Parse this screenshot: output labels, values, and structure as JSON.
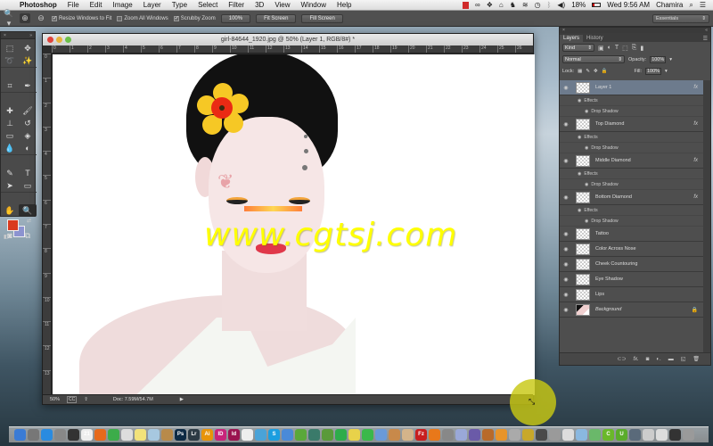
{
  "menubar": {
    "apple_icon": "apple-logo",
    "app_name": "Photoshop",
    "menus": [
      "File",
      "Edit",
      "Image",
      "Layer",
      "Type",
      "Select",
      "Filter",
      "3D",
      "View",
      "Window",
      "Help"
    ],
    "status_icons": [
      "creative-cloud-icon",
      "dropbox-icon",
      "home-icon",
      "evernote-icon",
      "wifi-icon",
      "time-machine-icon",
      "bluetooth-icon",
      "volume-icon"
    ],
    "battery": "18%",
    "clock": "Wed 9:56 AM",
    "user": "Chamira",
    "search_icon": "spotlight-icon",
    "list_icon": "notification-center-icon"
  },
  "options_bar": {
    "tool": "zoom-tool",
    "resize_windows": {
      "label": "Resize Windows to Fit",
      "checked": true
    },
    "zoom_all": {
      "label": "Zoom All Windows",
      "checked": false
    },
    "scrubby": {
      "label": "Scrubby Zoom",
      "checked": true
    },
    "btn_100": "100%",
    "btn_fit": "Fit Screen",
    "btn_fill": "Fill Screen",
    "workspace": "Essentials"
  },
  "tools": {
    "items": [
      "marquee",
      "move",
      "lasso",
      "magic-wand",
      "crop",
      "eyedropper",
      "healing",
      "brush",
      "stamp",
      "history-brush",
      "eraser",
      "paint-bucket",
      "blur",
      "dodge",
      "pen",
      "type",
      "path-select",
      "rectangle",
      "hand",
      "zoom"
    ],
    "glyphs": [
      "⬚",
      "✥",
      "➰",
      "✨",
      "⌗",
      "✒",
      "✚",
      "🖌",
      "⊥",
      "↺",
      "▭",
      "◈",
      "💧",
      "◐",
      "✎",
      "T",
      "➤",
      "▭",
      "✋",
      "🔍"
    ],
    "fg_color": "#d93a1f",
    "bg_color": "#8c93d0"
  },
  "document": {
    "title": "girl-84644_1920.jpg @ 50% (Layer 1, RGB/8#) *",
    "ruler_h": [
      "0",
      "1",
      "2",
      "3",
      "4",
      "5",
      "6",
      "7",
      "8",
      "9",
      "10",
      "11",
      "12",
      "13",
      "14",
      "15",
      "16",
      "17",
      "18",
      "19",
      "20",
      "21",
      "22",
      "23",
      "24",
      "25",
      "26"
    ],
    "ruler_v": [
      "0",
      "1",
      "2",
      "3",
      "4",
      "5",
      "6",
      "7",
      "8",
      "9",
      "10",
      "11",
      "12",
      "13"
    ],
    "zoom": "50%",
    "doc_size": "Doc: 7.59M/54.7M",
    "watermark": "www.cgtsj.com"
  },
  "layers_panel": {
    "tabs": [
      "Layers",
      "History"
    ],
    "filter_kind": "Kind",
    "blend_mode": "Normal",
    "opacity_label": "Opacity:",
    "opacity": "100%",
    "lock_label": "Lock:",
    "fill_label": "Fill:",
    "fill": "100%",
    "layers": [
      {
        "name": "Layer 1",
        "selected": true,
        "fx": true,
        "effects": [
          "Effects",
          "Drop Shadow"
        ]
      },
      {
        "name": "Top Diamond",
        "selected": false,
        "fx": true,
        "effects": [
          "Effects",
          "Drop Shadow"
        ]
      },
      {
        "name": "Middle Diamond",
        "selected": false,
        "fx": true,
        "effects": [
          "Effects",
          "Drop Shadow"
        ]
      },
      {
        "name": "Bottom Diamond",
        "selected": false,
        "fx": true,
        "effects": [
          "Effects",
          "Drop Shadow"
        ]
      },
      {
        "name": "Tattoo",
        "selected": false,
        "fx": false
      },
      {
        "name": "Color Across Nose",
        "selected": false,
        "fx": false
      },
      {
        "name": "Cheek Countouring",
        "selected": false,
        "fx": false
      },
      {
        "name": "Eye Shadow",
        "selected": false,
        "fx": false
      },
      {
        "name": "Lips",
        "selected": false,
        "fx": false
      },
      {
        "name": "Background",
        "selected": false,
        "fx": false,
        "locked": true,
        "italic": true
      }
    ],
    "fx_label": "fx",
    "bottom_icons": [
      "link-icon",
      "fx-icon",
      "mask-icon",
      "adjustment-icon",
      "group-folder-icon",
      "new-layer-icon",
      "trash-icon"
    ]
  },
  "dock": {
    "apps": [
      {
        "name": "finder",
        "label": "",
        "color": "#3a7bd5"
      },
      {
        "name": "launchpad",
        "label": "",
        "color": "#777777"
      },
      {
        "name": "app-store",
        "label": "",
        "color": "#2a8be0"
      },
      {
        "name": "system-preferences",
        "label": "",
        "color": "#888888"
      },
      {
        "name": "dashboard",
        "label": "",
        "color": "#333333"
      },
      {
        "name": "calendar",
        "label": "21",
        "color": "#eeeeee"
      },
      {
        "name": "firefox",
        "label": "",
        "color": "#e66a1c"
      },
      {
        "name": "chrome",
        "label": "",
        "color": "#3cac4a"
      },
      {
        "name": "textedit",
        "label": "",
        "color": "#dddddd"
      },
      {
        "name": "stickies",
        "label": "",
        "color": "#f2e27a"
      },
      {
        "name": "dvd-player",
        "label": "",
        "color": "#a7c8e0"
      },
      {
        "name": "preview",
        "label": "",
        "color": "#b88a4a"
      },
      {
        "name": "photoshop",
        "label": "Ps",
        "color": "#0d2a44"
      },
      {
        "name": "lightroom",
        "label": "Lr",
        "color": "#2c3a44"
      },
      {
        "name": "illustrator",
        "label": "Ai",
        "color": "#e8940a"
      },
      {
        "name": "indesign-cc",
        "label": "ID",
        "color": "#c8247a"
      },
      {
        "name": "indesign",
        "label": "Id",
        "color": "#9a1450"
      },
      {
        "name": "acrobat",
        "label": "",
        "color": "#eeeeee"
      },
      {
        "name": "vimeo",
        "label": "",
        "color": "#4aa3d8"
      },
      {
        "name": "skype",
        "label": "S",
        "color": "#1b9ee0"
      },
      {
        "name": "itunes",
        "label": "",
        "color": "#4a8ad8"
      },
      {
        "name": "deer-app",
        "label": "",
        "color": "#5aa83a"
      },
      {
        "name": "camera-app",
        "label": "",
        "color": "#3a7a6a"
      },
      {
        "name": "evernote-app",
        "label": "",
        "color": "#5a9a3a"
      },
      {
        "name": "evernote",
        "label": "",
        "color": "#2eac4a"
      },
      {
        "name": "notes-yellow",
        "label": "",
        "color": "#e8d24a"
      },
      {
        "name": "numbers",
        "label": "",
        "color": "#3ab84a"
      },
      {
        "name": "utility",
        "label": "",
        "color": "#6a9ad8"
      },
      {
        "name": "garageband",
        "label": "",
        "color": "#c8894a"
      },
      {
        "name": "box-app",
        "label": "",
        "color": "#d4b48a"
      },
      {
        "name": "filezilla",
        "label": "Fz",
        "color": "#c81e1e"
      },
      {
        "name": "presentation",
        "label": "",
        "color": "#e8781a"
      },
      {
        "name": "usb-utility",
        "label": "",
        "color": "#888888"
      },
      {
        "name": "mail-send",
        "label": "",
        "color": "#9aa8d8"
      },
      {
        "name": "pen-app",
        "label": "",
        "color": "#6a5aa8"
      },
      {
        "name": "animation-app",
        "label": "",
        "color": "#b86a2a"
      },
      {
        "name": "keynote",
        "label": "",
        "color": "#e8942a"
      },
      {
        "name": "time-machine-app",
        "label": "",
        "color": "#aaaaaa"
      },
      {
        "name": "tool-app",
        "label": "",
        "color": "#c8a82a"
      },
      {
        "name": "vlc",
        "label": "",
        "color": "#4a4a4a"
      },
      {
        "name": "game-app",
        "label": "",
        "color": "#9a9a9a"
      },
      {
        "name": "document-app",
        "label": "",
        "color": "#dddddd"
      },
      {
        "name": "image-capture",
        "label": "",
        "color": "#8ab8e0"
      },
      {
        "name": "home-app",
        "label": "",
        "color": "#6ab86a"
      },
      {
        "name": "camtasia",
        "label": "C",
        "color": "#6ab82a"
      },
      {
        "name": "u-app",
        "label": "U",
        "color": "#5aac2a"
      },
      {
        "name": "facetime",
        "label": "",
        "color": "#5a6a7a"
      },
      {
        "name": "downloads-stack",
        "label": "",
        "color": "#cccccc"
      },
      {
        "name": "documents-stack",
        "label": "",
        "color": "#dddddd"
      },
      {
        "name": "screen-stack",
        "label": "",
        "color": "#333333"
      },
      {
        "name": "trash",
        "label": "",
        "color": "#9a9a9a"
      }
    ]
  }
}
